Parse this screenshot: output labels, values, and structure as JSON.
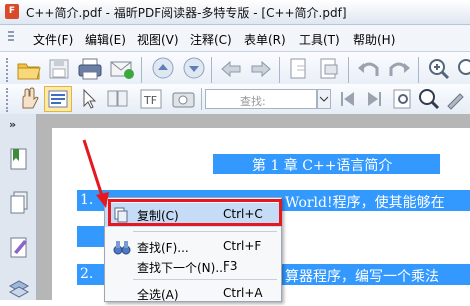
{
  "window": {
    "title": "C++简介.pdf - 福昕PDF阅读器-多特专版 - [C++简介.pdf]",
    "app_icon_text": "F"
  },
  "menu": {
    "items": [
      "文件(F)",
      "编辑(E)",
      "视图(V)",
      "注释(C)",
      "表单(R)",
      "工具(T)",
      "帮助(H)"
    ]
  },
  "toolbar2": {
    "find_label": "查找:"
  },
  "document": {
    "heading": "第 1 章  C++语言简介",
    "line1_num": "1.",
    "line1_tail": "World!程序，使其能够在",
    "line2_num": "2.",
    "line2_tail": "算器程序，编写一个乘法"
  },
  "context_menu": {
    "items": [
      {
        "label": "复制(C)",
        "shortcut": "Ctrl+C",
        "highlighted": true
      },
      {
        "label": "查找(F)...",
        "shortcut": "Ctrl+F"
      },
      {
        "label": "查找下一个(N)...",
        "shortcut": "F3"
      },
      {
        "label": "全选(A)",
        "shortcut": "Ctrl+A"
      }
    ]
  },
  "colors": {
    "selection": "#3399ff",
    "annotation": "#e4181e"
  }
}
